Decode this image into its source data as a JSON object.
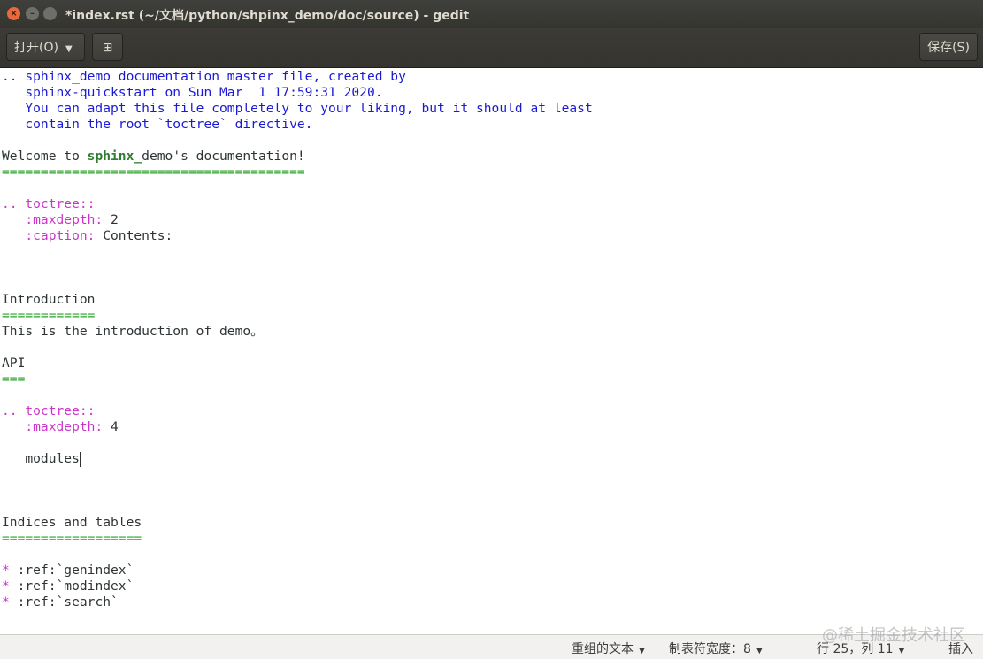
{
  "window": {
    "title": "*index.rst (~/文档/python/shpinx_demo/doc/source) - gedit",
    "close_glyph": "×",
    "min_glyph": "–",
    "max_glyph": ""
  },
  "toolbar": {
    "open_label": "打开(O)",
    "open_caret": "▼",
    "new_glyph": "⊞",
    "save_label": "保存(S)"
  },
  "editor": {
    "lines": [
      {
        "parts": [
          {
            "text": ".. sphinx_demo documentation master file, created by",
            "cls": "cmt"
          }
        ]
      },
      {
        "parts": [
          {
            "text": "   sphinx-quickstart on Sun Mar  1 17:59:31 2020.",
            "cls": "cmt"
          }
        ]
      },
      {
        "parts": [
          {
            "text": "   You can adapt this file completely to your liking, but it should at least",
            "cls": "cmt"
          }
        ]
      },
      {
        "parts": [
          {
            "text": "   contain the root `toctree` directive.",
            "cls": "cmt"
          }
        ]
      },
      {
        "parts": []
      },
      {
        "parts": [
          {
            "text": "Welcome to ",
            "cls": "plain"
          },
          {
            "text": "sphinx_",
            "cls": "bold"
          },
          {
            "text": "demo's documentation!",
            "cls": "plain"
          }
        ]
      },
      {
        "parts": [
          {
            "text": "=======================================",
            "cls": "ul"
          }
        ]
      },
      {
        "parts": []
      },
      {
        "parts": [
          {
            "text": ".. toctree::",
            "cls": "dir"
          }
        ]
      },
      {
        "parts": [
          {
            "text": "   :maxdepth:",
            "cls": "dir"
          },
          {
            "text": " 2",
            "cls": "plain"
          }
        ]
      },
      {
        "parts": [
          {
            "text": "   :caption:",
            "cls": "dir"
          },
          {
            "text": " Contents:",
            "cls": "plain"
          }
        ]
      },
      {
        "parts": []
      },
      {
        "parts": []
      },
      {
        "parts": []
      },
      {
        "parts": [
          {
            "text": "Introduction",
            "cls": "plain"
          }
        ]
      },
      {
        "parts": [
          {
            "text": "============",
            "cls": "ul"
          }
        ]
      },
      {
        "parts": [
          {
            "text": "This is the introduction of demo。",
            "cls": "plain"
          }
        ]
      },
      {
        "parts": []
      },
      {
        "parts": [
          {
            "text": "API",
            "cls": "plain"
          }
        ]
      },
      {
        "parts": [
          {
            "text": "===",
            "cls": "ul"
          }
        ]
      },
      {
        "parts": []
      },
      {
        "parts": [
          {
            "text": ".. toctree::",
            "cls": "dir"
          }
        ]
      },
      {
        "parts": [
          {
            "text": "   :maxdepth:",
            "cls": "dir"
          },
          {
            "text": " 4",
            "cls": "plain"
          }
        ]
      },
      {
        "parts": []
      },
      {
        "parts": [
          {
            "text": "   modules",
            "cls": "plain"
          }
        ],
        "cursor": true
      },
      {
        "parts": []
      },
      {
        "parts": []
      },
      {
        "parts": []
      },
      {
        "parts": [
          {
            "text": "Indices and tables",
            "cls": "plain"
          }
        ]
      },
      {
        "parts": [
          {
            "text": "==================",
            "cls": "ul"
          }
        ]
      },
      {
        "parts": []
      },
      {
        "parts": [
          {
            "text": "*",
            "cls": "dir"
          },
          {
            "text": " :ref:`genindex`",
            "cls": "plain"
          }
        ]
      },
      {
        "parts": [
          {
            "text": "*",
            "cls": "dir"
          },
          {
            "text": " :ref:`modindex`",
            "cls": "plain"
          }
        ]
      },
      {
        "parts": [
          {
            "text": "*",
            "cls": "dir"
          },
          {
            "text": " :ref:`search`",
            "cls": "plain"
          }
        ]
      }
    ]
  },
  "status": {
    "language": "重组的文本",
    "tab_width": "制表符宽度：8",
    "position": "行 25，列 11",
    "mode": "插入",
    "caret": "▼",
    "watermark": "@稀土掘金技术社区"
  },
  "colors": {
    "comment": "#1a1ad6",
    "directive": "#cc33cc",
    "underline": "#27a327",
    "strong": "#2e7d32"
  }
}
